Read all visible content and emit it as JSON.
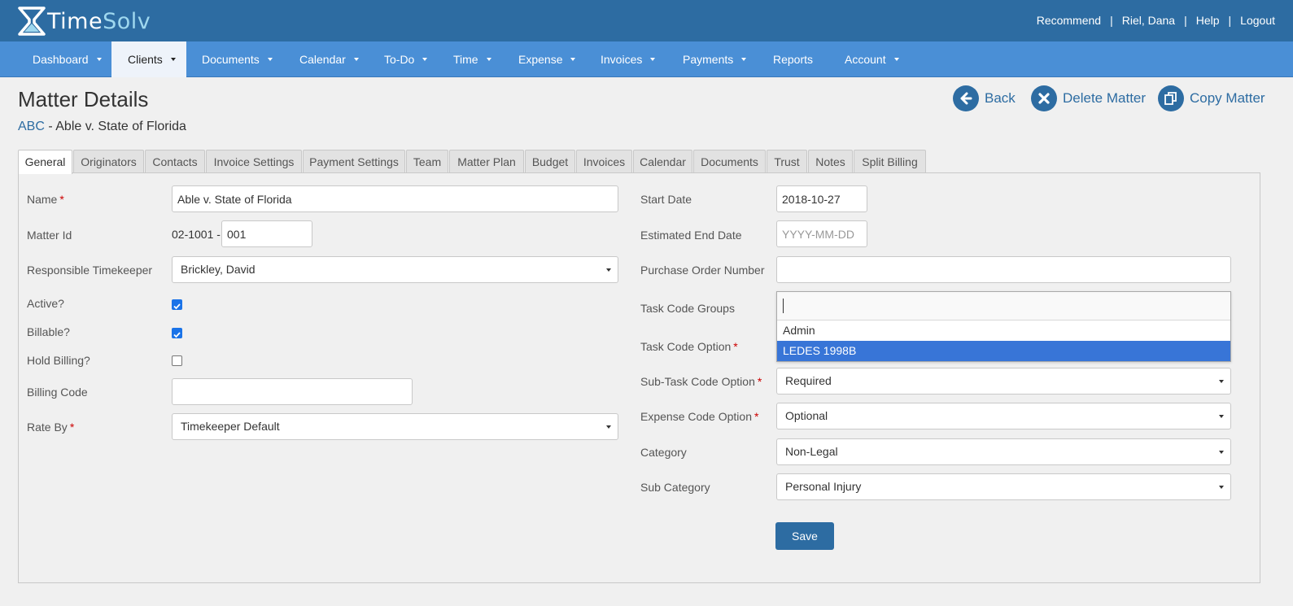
{
  "brand": {
    "time": "Time",
    "solv": "Solv"
  },
  "header_links": [
    "Recommend",
    "Riel, Dana",
    "Help",
    "Logout"
  ],
  "nav": [
    {
      "label": "Dashboard",
      "caret": true
    },
    {
      "label": "Clients",
      "caret": true,
      "active": true
    },
    {
      "label": "Documents",
      "caret": true
    },
    {
      "label": "Calendar",
      "caret": true
    },
    {
      "label": "To-Do",
      "caret": true
    },
    {
      "label": "Time",
      "caret": true
    },
    {
      "label": "Expense",
      "caret": true
    },
    {
      "label": "Invoices",
      "caret": true
    },
    {
      "label": "Payments",
      "caret": true
    },
    {
      "label": "Reports",
      "caret": false
    },
    {
      "label": "Account",
      "caret": true
    }
  ],
  "page": {
    "title": "Matter Details",
    "client_code": "ABC",
    "separator": " - ",
    "matter_name": "Able v. State of Florida"
  },
  "actions": {
    "back": "Back",
    "delete": "Delete Matter",
    "copy": "Copy Matter"
  },
  "tabs": [
    "General",
    "Originators",
    "Contacts",
    "Invoice Settings",
    "Payment Settings",
    "Team",
    "Matter Plan",
    "Budget",
    "Invoices",
    "Calendar",
    "Documents",
    "Trust",
    "Notes",
    "Split Billing"
  ],
  "left_form": {
    "name_label": "Name",
    "name_value": "Able v. State of Florida",
    "matter_id_label": "Matter Id",
    "matter_id_prefix": "02-1001 -",
    "matter_id_value": "001",
    "responsible_label": "Responsible Timekeeper",
    "responsible_value": "Brickley, David",
    "active_label": "Active?",
    "active_checked": true,
    "billable_label": "Billable?",
    "billable_checked": true,
    "hold_label": "Hold Billing?",
    "hold_checked": false,
    "billing_code_label": "Billing Code",
    "billing_code_value": "",
    "rate_by_label": "Rate By",
    "rate_by_value": "Timekeeper Default"
  },
  "right_form": {
    "start_date_label": "Start Date",
    "start_date_value": "2018-10-27",
    "est_end_label": "Estimated End Date",
    "est_end_placeholder": "YYYY-MM-DD",
    "po_label": "Purchase Order Number",
    "po_value": "",
    "task_groups_label": "Task Code Groups",
    "task_groups_options": [
      "Admin",
      "LEDES 1998B"
    ],
    "task_groups_highlighted": "LEDES 1998B",
    "task_option_label": "Task Code Option",
    "subtask_label": "Sub-Task Code Option",
    "subtask_value": "Required",
    "expense_label": "Expense Code Option",
    "expense_value": "Optional",
    "category_label": "Category",
    "category_value": "Non-Legal",
    "subcategory_label": "Sub Category",
    "subcategory_value": "Personal Injury",
    "save_label": "Save"
  },
  "colors": {
    "header": "#2d6ca2",
    "nav": "#4a8fd6",
    "highlight": "#3875d7",
    "required": "#cc0000"
  }
}
